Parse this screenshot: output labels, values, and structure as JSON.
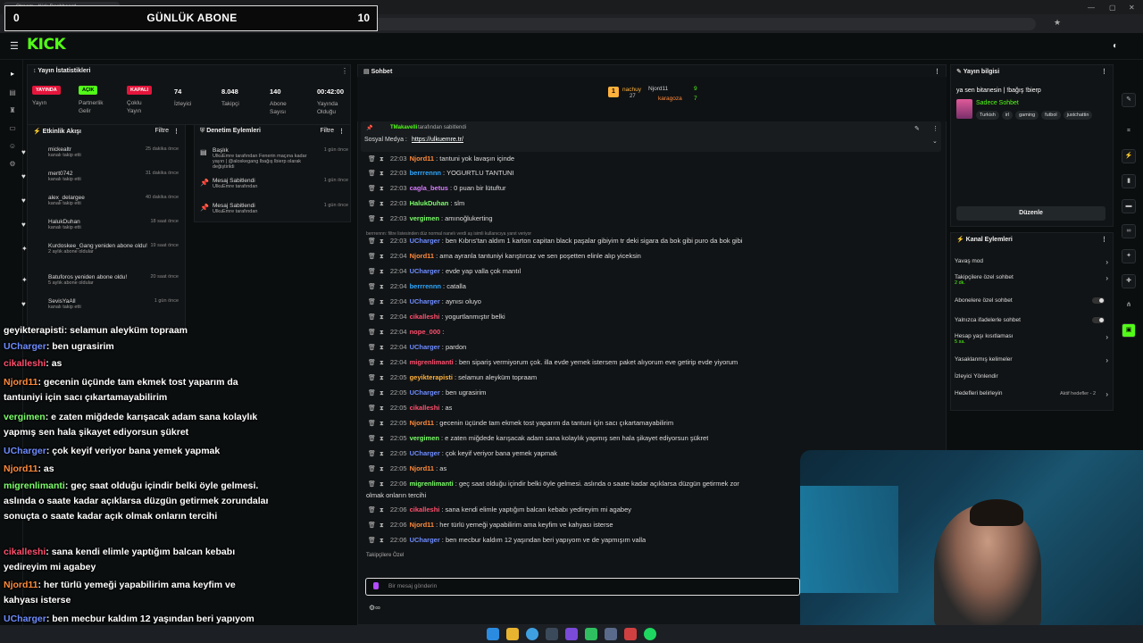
{
  "browser": {
    "tab_title": "Stream - Kick Dashboard",
    "url": "https://dashboard.kick.com/stream"
  },
  "overlay": {
    "title": "GÜNLÜK ABONE",
    "left_value": "0",
    "right_value": "10"
  },
  "brand": {
    "logo": "KICK",
    "accent": "#53fc18"
  },
  "stats": {
    "title": "Yayın İstatistikleri",
    "items": [
      {
        "badge": "YAYINDA",
        "label": "Yayın"
      },
      {
        "badge": "AÇIK",
        "label": "Partnerlik Gelir"
      },
      {
        "badge": "KAPALI",
        "label": "Çoklu Yayın"
      },
      {
        "value": "74",
        "label": "İzleyici"
      },
      {
        "value": "8.048",
        "label": "Takipçi"
      },
      {
        "value": "140",
        "label": "Abone Sayısı"
      },
      {
        "value": "00:42:00",
        "label": "Yayında Olduğu"
      }
    ]
  },
  "activity": {
    "title": "Etkinlik Akışı",
    "filter": "Filtre",
    "items": [
      {
        "name": "mickealtr",
        "sub": "kanalı takip etti",
        "time": "25 dakika önce"
      },
      {
        "name": "mert0742",
        "sub": "kanalı takip etti",
        "time": "31 dakika önce"
      },
      {
        "name": "alex_delargee",
        "sub": "kanalı takip etti",
        "time": "40 dakika önce"
      },
      {
        "name": "HalukDuhan",
        "sub": "kanalı takip etti",
        "time": "18 saat önce"
      },
      {
        "name": "Kurdoskee_Gang yeniden abone oldu!",
        "sub": "2 aylık abone oldular",
        "time": "19 saat önce"
      },
      {
        "name": "Batuforos yeniden abone oldu!",
        "sub": "5 aylık abone oldular",
        "time": "20 saat önce"
      },
      {
        "name": "SevisYaAll",
        "sub": "kanalı takip etti",
        "time": "1 gün önce"
      },
      {
        "name": "SevisYaAll",
        "sub": "kanalı takip etti",
        "time": "1 gün önce"
      }
    ]
  },
  "moderation": {
    "title": "Denetim Eylemleri",
    "filter": "Filtre",
    "items": [
      {
        "name": "Başlık",
        "sub": "UlkuEmre tarafından Fenerin maçına kadar yayın | @aloskegang lbağış lbierp olarak değiştirildi",
        "time": "1 gün önce"
      },
      {
        "name": "Mesaj Sabitlendi",
        "sub": "UlkuEmre tarafından",
        "time": "1 gün önce"
      },
      {
        "name": "Mesaj Sabitlendi",
        "sub": "UlkuEmre tarafından",
        "time": "1 gün önce"
      }
    ]
  },
  "overlay_chat": [
    {
      "user": "geyikterapisti",
      "color": "#ffffff",
      "text": ": selamun aleyküm topraam"
    },
    {
      "user": "UCharger",
      "color": "#6e8cff",
      "text": ": ben ugrasirim"
    },
    {
      "user": "cikalleshi",
      "color": "#ff4f6e",
      "text": ": as"
    },
    {
      "user": "Njord11",
      "color": "#ff8a3c",
      "text": ": gecenin üçünde tam ekmek tost yaparım da tantuniyi için sacı çıkartamayabilirim"
    },
    {
      "user": "vergimen",
      "color": "#7cff6b",
      "text": ": e zaten miğdede karışacak adam sana kolaylık yapmış sen hala şikayet ediyorsun şükret"
    },
    {
      "user": "UCharger",
      "color": "#6e8cff",
      "text": ": çok keyif veriyor bana yemek yapmak"
    },
    {
      "user": "Njord11",
      "color": "#ff8a3c",
      "text": ": as"
    },
    {
      "user": "migrenlimanti",
      "color": "#7cff6b",
      "text": ": geç saat olduğu içindir belki öyle gelmesi. aslında o saate kadar açıklarsa düzgün getirmek zorundalar. sonuçta o saate kadar açık olmak onların tercihi"
    },
    {
      "user": "cikalleshi",
      "color": "#ff4f6e",
      "text": ": sana kendi elimle yaptığım balcan kebabı yedireyim mi agabey"
    },
    {
      "user": "Njord11",
      "color": "#ff8a3c",
      "text": ": her türlü yemeği yapabilirim ama keyfim ve kahyası isterse"
    },
    {
      "user": "UCharger",
      "color": "#6e8cff",
      "text": ": ben mecbur kaldım 12 yaşından beri yapıyom iyiki de yapmışım valla"
    }
  ],
  "chat": {
    "title": "Sohbet",
    "top": [
      {
        "name": "nachuy",
        "count": "27"
      },
      {
        "name": "Njord11",
        "count": "9"
      },
      {
        "name": "karagoza",
        "count": "7"
      }
    ],
    "pinned": {
      "by": "TMakavelli",
      "by_suffix": "tarafından sabitlendi",
      "label": "Sosyal Medya :",
      "link": "https://ulkuemre.tr/"
    },
    "messages": [
      {
        "time": "22:03",
        "user": "Njord11",
        "color": "#ff8a3c",
        "text": "tantuni yok lavaşın içinde"
      },
      {
        "time": "22:03",
        "user": "berrrennn",
        "color": "#2ea8ff",
        "text": "YOGURTLU TANTUNI"
      },
      {
        "time": "22:03",
        "user": "cagla_betus",
        "color": "#d77bff",
        "text": "0 puan bir lütuftur"
      },
      {
        "time": "22:03",
        "user": "HalukDuhan",
        "color": "#7cff6b",
        "text": "slm"
      },
      {
        "time": "22:03",
        "user": "vergimen",
        "color": "#7cff6b",
        "text": "amınoğlukerting"
      },
      {
        "time": "22:03",
        "user": "UCharger",
        "color": "#6e8cff",
        "text": "ben Kıbrıs'tan aldım 1 karton capitan black paşalar gibiyim tr deki sigara da bok gibi puro da bok gibi"
      },
      {
        "time": "22:04",
        "user": "Njord11",
        "color": "#ff8a3c",
        "text": "ama ayranla tantuniyi karıştırcaz ve sen poşetten elinle alıp yiceksin"
      },
      {
        "time": "22:04",
        "user": "UCharger",
        "color": "#6e8cff",
        "text": "evde yap valla çok mantıl"
      },
      {
        "time": "22:04",
        "user": "berrrennn",
        "color": "#2ea8ff",
        "text": "catalla"
      },
      {
        "time": "22:04",
        "user": "UCharger",
        "color": "#6e8cff",
        "text": "aynısı oluyo"
      },
      {
        "time": "22:04",
        "user": "cikalleshi",
        "color": "#ff4f6e",
        "text": "yogurtlanmıştır belki"
      },
      {
        "time": "22:04",
        "user": "nope_000",
        "color": "#ff4f6e",
        "text": ""
      },
      {
        "time": "22:04",
        "user": "UCharger",
        "color": "#6e8cff",
        "text": "pardon"
      },
      {
        "time": "22:04",
        "user": "migrenlimanti",
        "color": "#ff4f6e",
        "text": "ben sipariş vermiyorum çok. illa evde yemek istersem paket alıyorum eve getirip evde yiyorum"
      },
      {
        "time": "22:05",
        "user": "geyikterapisti",
        "color": "#ffb13c",
        "text": "selamun aleyküm topraam"
      },
      {
        "time": "22:05",
        "user": "UCharger",
        "color": "#6e8cff",
        "text": "ben ugrasirim"
      },
      {
        "time": "22:05",
        "user": "cikalleshi",
        "color": "#ff4f6e",
        "text": "as"
      },
      {
        "time": "22:05",
        "user": "Njord11",
        "color": "#ff8a3c",
        "text": "gecenin üçünde tam ekmek tost yaparım da tantuni için sacı çıkartamayabilirim"
      },
      {
        "time": "22:05",
        "user": "vergimen",
        "color": "#7cff6b",
        "text": "e zaten miğdede karışacak adam sana kolaylık yapmış sen hala şikayet ediyorsun şükret"
      },
      {
        "time": "22:05",
        "user": "UCharger",
        "color": "#6e8cff",
        "text": "çok keyif veriyor bana yemek yapmak"
      },
      {
        "time": "22:05",
        "user": "Njord11",
        "color": "#ff8a3c",
        "text": "as"
      },
      {
        "time": "22:06",
        "user": "migrenlimanti",
        "color": "#7cff6b",
        "text": "geç saat olduğu içindir belki öyle gelmesi. aslında o saate kadar açıklarsa düzgün getirmek zor"
      },
      {
        "time": "22:06",
        "user": "cikalleshi",
        "color": "#ff4f6e",
        "text": "sana kendi elimle yaptığım balcan kebabı yedireyim mi agabey"
      },
      {
        "time": "22:06",
        "user": "Njord11",
        "color": "#ff8a3c",
        "text": "her türlü yemeği yapabilirim ama keyfim ve kahyası isterse"
      },
      {
        "time": "22:06",
        "user": "UCharger",
        "color": "#6e8cff",
        "text": "ben mecbur kaldım 12 yaşından beri yapıyom ve de yapmışım valla"
      }
    ],
    "wrap_line": "olmak onların tercihi",
    "filter_note": "berrrennn: filtre listesinden düz normal nanelı verdi aş isimli kullanıcıya yanıt veriyor",
    "followers_only": "Takipçilere Özel",
    "input_placeholder": "Bir mesaj gönderin"
  },
  "stream_info": {
    "title": "Yayın bilgisi",
    "stream_title": "ya sen bitanesin | !bağış !bierp",
    "category": "Sadece Sohbet",
    "tags": [
      "Turkish",
      "irl",
      "gaming",
      "futbol",
      "justchattin"
    ],
    "edit_button": "Düzenle"
  },
  "channel_actions": {
    "title": "Kanal Eylemleri",
    "items": [
      {
        "label": "Yavaş mod",
        "kind": "chevron"
      },
      {
        "label": "Takipçilere özel sohbet",
        "sub": "2 dk.",
        "kind": "chevron"
      },
      {
        "label": "Abonelere özel sohbet",
        "kind": "toggle"
      },
      {
        "label": "Yalnızca ifadelerle sohbet",
        "kind": "toggle"
      },
      {
        "label": "Hesap yaşı kısıtlaması",
        "sub": "5 sa.",
        "kind": "chevron"
      },
      {
        "label": "Yasaklanmış kelimeler",
        "kind": "chevron"
      },
      {
        "label": "İzleyici Yönlendir",
        "kind": "none"
      },
      {
        "label": "Hedefleri belirleyin",
        "sub_right": "Aktif hedefler - 2",
        "kind": "chevron"
      }
    ]
  }
}
